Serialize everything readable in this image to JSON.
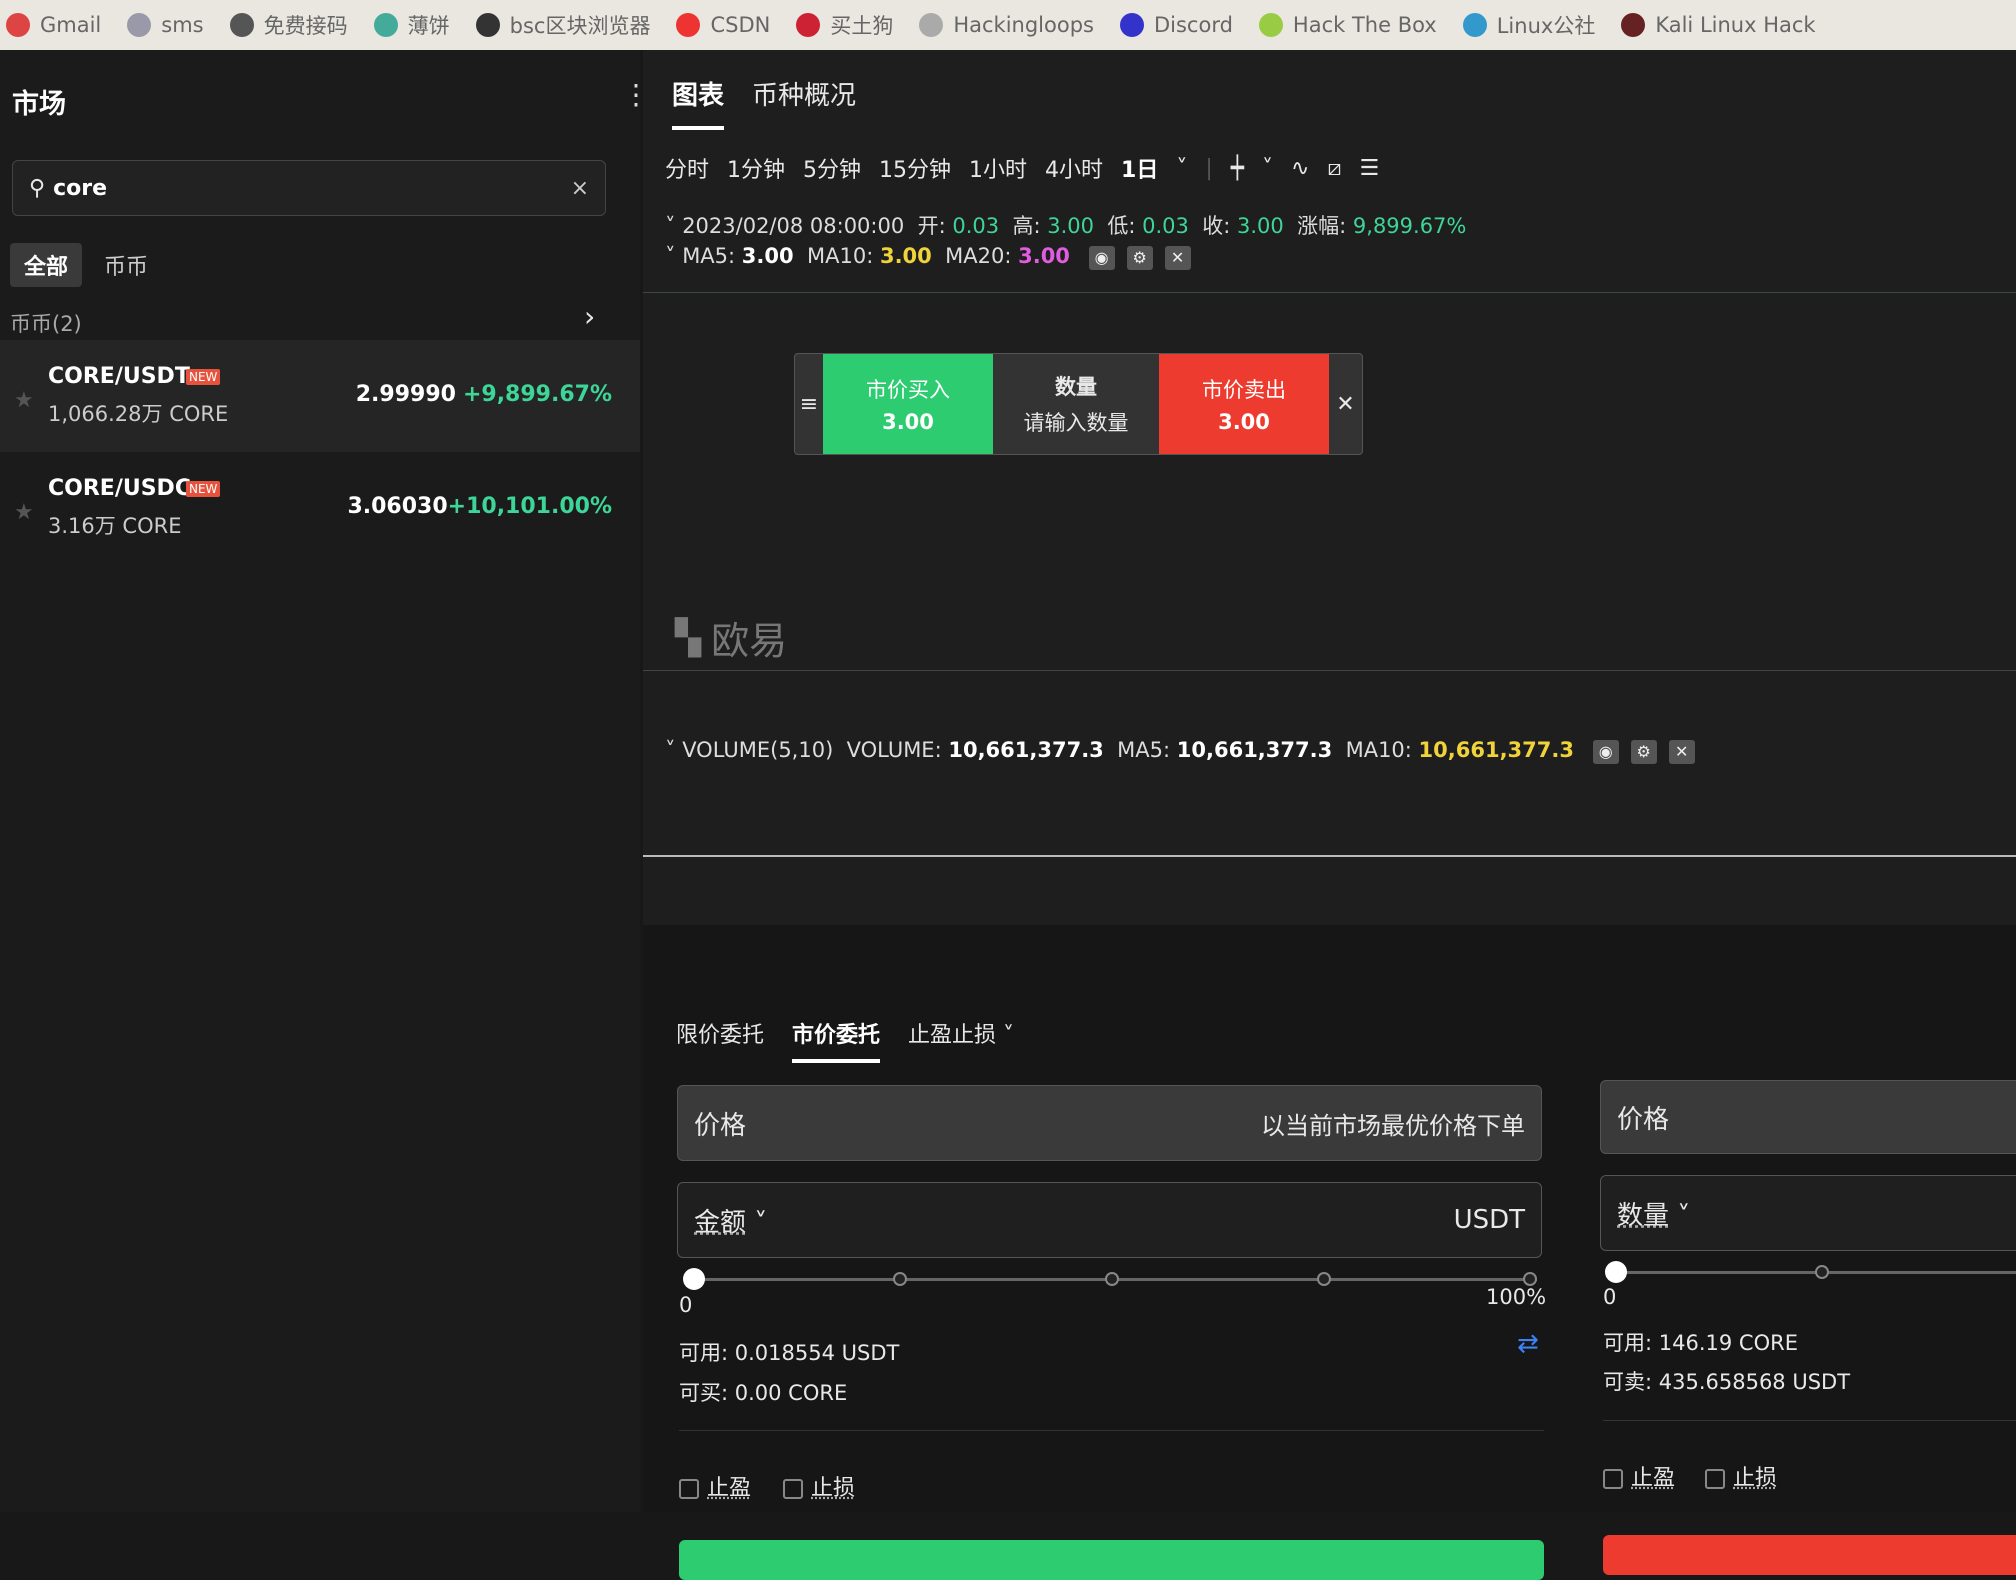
{
  "bookmarks": [
    "Gmail",
    "sms",
    "免费接码",
    "薄饼",
    "bsc区块浏览器",
    "CSDN",
    "买土狗",
    "Hackingloops",
    "Discord",
    "Hack The Box",
    "Linux公社",
    "Kali Linux Hack"
  ],
  "bookmark_colors": [
    "#d44",
    "#99a",
    "#555",
    "#4a9",
    "#333",
    "#e33",
    "#c23",
    "#aaa",
    "#33c",
    "#9c4",
    "#39c",
    "#622"
  ],
  "sidebar": {
    "title": "市场",
    "search_value": "core",
    "clear": "×",
    "filters": [
      "全部",
      "币币"
    ],
    "section": "币币(2)",
    "rows": [
      {
        "pair": "CORE/USDT",
        "badge": "NEW",
        "volume": "1,066.28万 CORE",
        "price": "2.99990",
        "change": "+9,899.67%"
      },
      {
        "pair": "CORE/USDC",
        "badge": "NEW",
        "volume": "3.16万 CORE",
        "price": "3.06030",
        "change": "+10,101.00%"
      }
    ]
  },
  "tabs": [
    "图表",
    "币种概况"
  ],
  "intervals": [
    "分时",
    "1分钟",
    "5分钟",
    "15分钟",
    "1小时",
    "4小时",
    "1日"
  ],
  "ohlc": {
    "date": "2023/02/08 08:00:00",
    "open_l": "开:",
    "open": "0.03",
    "high_l": "高:",
    "high": "3.00",
    "low_l": "低:",
    "low": "0.03",
    "close_l": "收:",
    "close": "3.00",
    "chg_l": "涨幅:",
    "chg": "9,899.67%"
  },
  "ma": {
    "ma5_l": "MA5:",
    "ma5": "3.00",
    "ma10_l": "MA10:",
    "ma10": "3.00",
    "ma20_l": "MA20:",
    "ma20": "3.00"
  },
  "quick": {
    "buy": "市价买入",
    "buy_price": "3.00",
    "qty": "数量",
    "qty_ph": "请输入数量",
    "sell": "市价卖出",
    "sell_price": "3.00"
  },
  "watermark": "欧易",
  "volume": {
    "label": "VOLUME(5,10)",
    "vol_l": "VOLUME:",
    "vol": "10,661,377.3",
    "ma5_l": "MA5:",
    "ma5": "10,661,377.3",
    "ma10_l": "MA10:",
    "ma10": "10,661,377.3"
  },
  "order": {
    "tabs": [
      "限价委托",
      "市价委托",
      "止盈止损"
    ],
    "buy": {
      "price_l": "价格",
      "price_hint": "以当前市场最优价格下单",
      "amount_l": "金额",
      "unit": "USDT",
      "min": "0",
      "max": "100%",
      "avail": "可用: 0.018554 USDT",
      "can": "可买: 0.00 CORE",
      "tp": "止盈",
      "sl": "止损",
      "slider_pct": 0
    },
    "sell": {
      "price_l": "价格",
      "amount_l": "数量",
      "min": "0",
      "avail": "可用: 146.19 CORE",
      "can": "可卖: 435.658568 USDT",
      "tp": "止盈",
      "sl": "止损",
      "slider_pct": 0
    }
  },
  "colors": {
    "up": "#3ed598",
    "buy": "#2ecc71",
    "sell": "#ee3b2f",
    "ma10": "#f0d33a",
    "ma20": "#e05de0"
  }
}
